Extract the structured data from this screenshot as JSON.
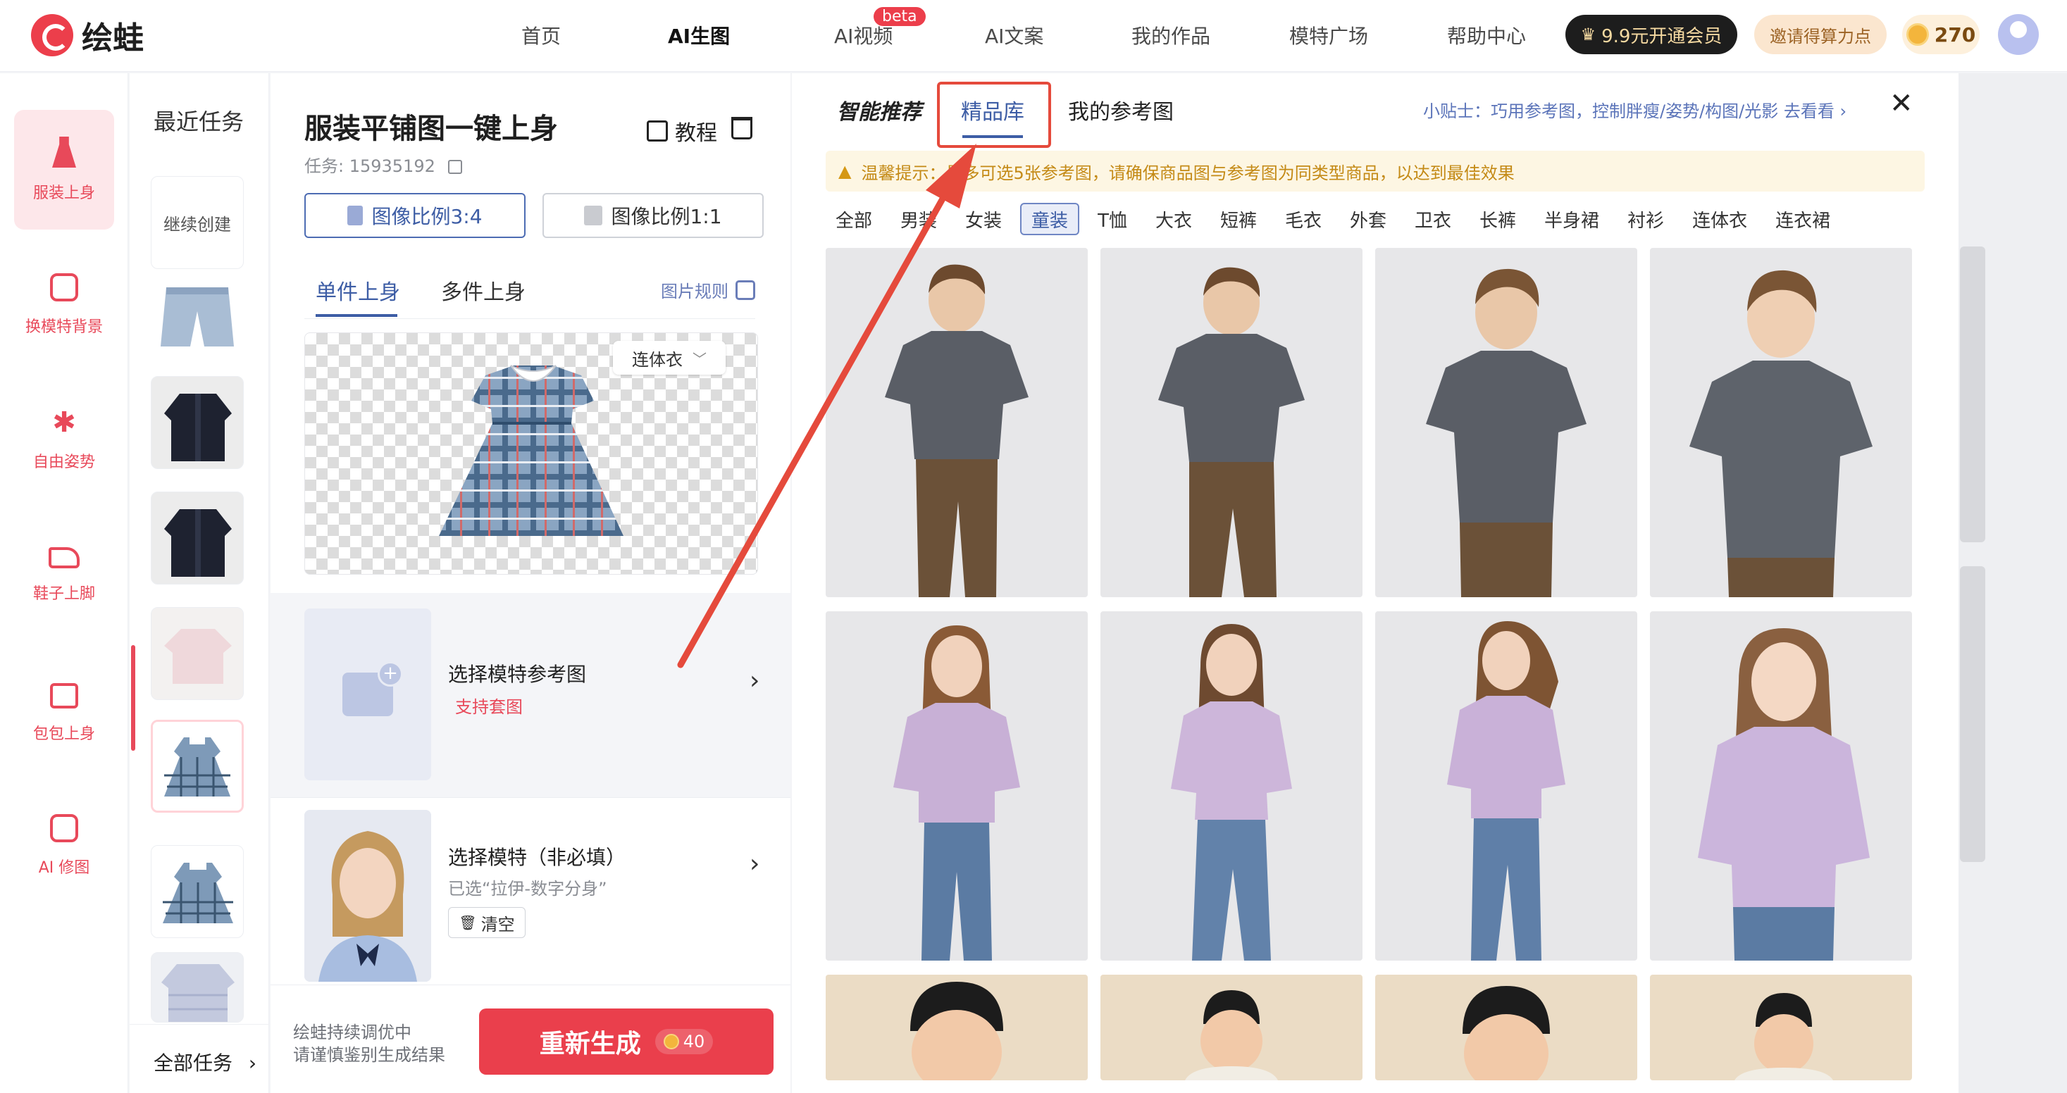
{
  "app": {
    "logo_text": "绘蛙",
    "nav": [
      "首页",
      "AI生图",
      "AI视频",
      "AI文案",
      "我的作品",
      "模特广场",
      "帮助中心"
    ],
    "nav_active": "AI生图",
    "beta_badge": "beta",
    "vip_button": "9.9元开通会员",
    "invite_button": "邀请得算力点",
    "points": "270"
  },
  "sidebar": [
    {
      "label": "服装上身",
      "icon": "dress-icon",
      "active": true
    },
    {
      "label": "换模特背景",
      "icon": "portrait-icon",
      "active": false
    },
    {
      "label": "自由姿势",
      "icon": "pose-icon",
      "active": false
    },
    {
      "label": "鞋子上脚",
      "icon": "shoe-icon",
      "active": false
    },
    {
      "label": "包包上身",
      "icon": "bag-icon",
      "active": false
    },
    {
      "label": "AI 修图",
      "icon": "retouch-icon",
      "active": false
    }
  ],
  "recent": {
    "title": "最近任务",
    "continue_create": "继续创建",
    "all_tasks": "全部任务",
    "all_tasks_chevron": "›"
  },
  "config": {
    "title": "服装平铺图一键上身",
    "task_id": "任务: 15935192",
    "tutorial": "教程",
    "ratio_34": "图像比例3:4",
    "ratio_11": "图像比例1:1",
    "tab_single": "单件上身",
    "tab_multi": "多件上身",
    "image_rules": "图片规则",
    "garment_type": "连体衣",
    "ref_title": "选择模特参考图",
    "ref_sub": "支持套图",
    "model_title": "选择模特（非必填）",
    "model_selected": "已选“拉伊-数字分身”",
    "clear": "清空",
    "footer_note_1": "绘蛙持续调优中",
    "footer_note_2": "请谨慎鉴别生成结果",
    "regenerate": "重新生成",
    "cost": "40"
  },
  "library": {
    "tab_smart": "智能推荐",
    "tab_premium": "精品库",
    "tab_mine": "我的参考图",
    "tip": "小贴士：巧用参考图，控制胖瘦/姿势/构图/光影 去看看 ›",
    "close": "✕",
    "warning": "温馨提示：最多可选5张参考图，请确保商品图与参考图为同类型商品，以达到最佳效果",
    "categories": [
      "全部",
      "男装",
      "女装",
      "童装",
      "T恤",
      "大衣",
      "短裤",
      "毛衣",
      "外套",
      "卫衣",
      "长裤",
      "半身裙",
      "衬衫",
      "连体衣",
      "连衣裙"
    ],
    "active_category": "童装"
  },
  "colors": {
    "accent_red": "#ea3f4c",
    "accent_blue": "#3d5da5",
    "warn_text": "#c48a16",
    "annotation_red": "#e54a3c"
  }
}
